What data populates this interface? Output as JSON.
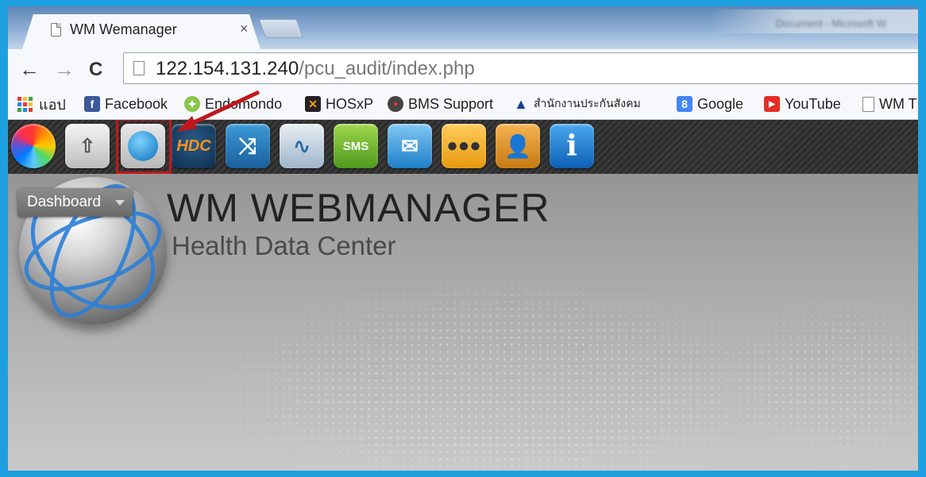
{
  "browser": {
    "tab": {
      "title": "WM Wemanager",
      "close": "×"
    },
    "titlebar_right": "Document - Microsoft W",
    "nav": {
      "back": "←",
      "forward": "→",
      "reload": "C"
    },
    "url": {
      "host": "122.154.131.240",
      "path": "/pcu_audit/index.php"
    }
  },
  "bookmarks": [
    {
      "label": "แอป",
      "icon": "apps-icon"
    },
    {
      "label": "Facebook",
      "icon": "facebook-icon"
    },
    {
      "label": "Endomondo",
      "icon": "endomondo-icon"
    },
    {
      "label": "HOSxP",
      "icon": "hosxp-icon"
    },
    {
      "label": "BMS Support",
      "icon": "bms-icon"
    },
    {
      "label": "สำนักงานประกันสังคม",
      "icon": "sso-icon"
    },
    {
      "label": "Google",
      "icon": "google-icon"
    },
    {
      "label": "YouTube",
      "icon": "youtube-icon"
    },
    {
      "label": "WM T",
      "icon": "page-icon"
    }
  ],
  "app_icons": [
    {
      "name": "color-wheel-icon"
    },
    {
      "name": "router-icon"
    },
    {
      "name": "health-service-icon",
      "highlighted": true
    },
    {
      "name": "hdc-icon",
      "label": "HDC"
    },
    {
      "name": "transfer-icon"
    },
    {
      "name": "monitor-pulse-icon"
    },
    {
      "name": "sms-icon",
      "label": "SMS"
    },
    {
      "name": "mail-icon"
    },
    {
      "name": "users-group-icon"
    },
    {
      "name": "contact-icon"
    },
    {
      "name": "info-icon",
      "label": "i"
    }
  ],
  "page": {
    "dashboard_label": "Dashboard",
    "brand_title": "WM WEBMANAGER",
    "brand_subtitle": "Health Data Center"
  },
  "colors": {
    "screenshot_border": "#1ea0e0",
    "highlight": "#c0171d",
    "icon_bar": "#333333"
  }
}
